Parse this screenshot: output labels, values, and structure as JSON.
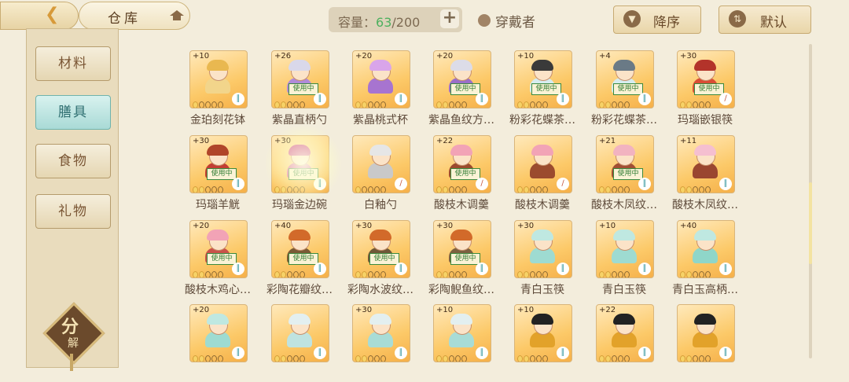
{
  "header": {
    "title": "仓库",
    "capacity_label": "容量：",
    "capacity_current": "63",
    "capacity_max": "/200",
    "capacity_add_icon": "plus-icon",
    "wearer_label": "穿戴者",
    "sort_order_label": "降序",
    "sort_default_label": "默认"
  },
  "sidebar": {
    "categories": [
      {
        "label": "材料",
        "active": false
      },
      {
        "label": "膳具",
        "active": true
      },
      {
        "label": "食物",
        "active": false
      },
      {
        "label": "礼物",
        "active": false
      }
    ],
    "decompose_label": "分",
    "decompose_sub": "解"
  },
  "status_badge_text": "使用中",
  "items": [
    {
      "name": "金珀刻花钵",
      "level": "+10",
      "in_use": false,
      "stars": 1,
      "tool": "teal",
      "hair": "#e9b850",
      "body": "#f2d58b"
    },
    {
      "name": "紫晶直柄勺",
      "level": "+26",
      "in_use": true,
      "stars": 2,
      "tool": "teal",
      "hair": "#d9d8ea",
      "body": "#b08ad8"
    },
    {
      "name": "紫晶桃式杯",
      "level": "+20",
      "in_use": false,
      "stars": 2,
      "tool": "teal",
      "hair": "#d9a5ea",
      "body": "#a774d0"
    },
    {
      "name": "紫晶鱼纹方…",
      "level": "+20",
      "in_use": true,
      "stars": 2,
      "tool": "teal",
      "hair": "#dcdce8",
      "body": "#9a6fc8"
    },
    {
      "name": "粉彩花蝶茶…",
      "level": "+10",
      "in_use": true,
      "stars": 2,
      "tool": "teal",
      "hair": "#3a3a3a",
      "body": "#d6ecef"
    },
    {
      "name": "粉彩花蝶茶…",
      "level": "+4",
      "in_use": true,
      "stars": 2,
      "tool": "teal",
      "hair": "#6a7a86",
      "body": "#d6ecef"
    },
    {
      "name": "玛瑙嵌银筷",
      "level": "+30",
      "in_use": true,
      "stars": 2,
      "tool": "red",
      "hair": "#b3332a",
      "body": "#d94d36"
    },
    {
      "name": "玛瑙羊觥",
      "level": "+30",
      "in_use": true,
      "stars": 2,
      "tool": "teal",
      "hair": "#b0452a",
      "body": "#c23d33"
    },
    {
      "name": "玛瑙金边碗",
      "level": "+30",
      "in_use": true,
      "stars": 2,
      "tool": "teal",
      "hair": "#cf4e9a",
      "body": "#d65ea6"
    },
    {
      "name": "白釉勺",
      "level": "",
      "in_use": false,
      "stars": 1,
      "tool": "red",
      "hair": "#e6e6e6",
      "body": "#c9c9c9"
    },
    {
      "name": "酸枝木调羹",
      "level": "+22",
      "in_use": true,
      "stars": 2,
      "tool": "red",
      "hair": "#f2a3b6",
      "body": "#9b4b2e"
    },
    {
      "name": "酸枝木调羹",
      "level": "",
      "in_use": false,
      "stars": 2,
      "tool": "red",
      "hair": "#f2a3b6",
      "body": "#9b4b2e"
    },
    {
      "name": "酸枝木凤纹…",
      "level": "+21",
      "in_use": true,
      "stars": 2,
      "tool": "teal",
      "hair": "#f2b3c0",
      "body": "#a14f34"
    },
    {
      "name": "酸枝木凤纹…",
      "level": "+11",
      "in_use": false,
      "stars": 2,
      "tool": "teal",
      "hair": "#f5bfd0",
      "body": "#9a4630"
    },
    {
      "name": "酸枝木鸡心…",
      "level": "+20",
      "in_use": true,
      "stars": 2,
      "tool": "teal",
      "hair": "#f2a3b6",
      "body": "#c9534a"
    },
    {
      "name": "彩陶花瓣纹…",
      "level": "+40",
      "in_use": true,
      "stars": 2,
      "tool": "teal",
      "hair": "#d26a2a",
      "body": "#7a5a36"
    },
    {
      "name": "彩陶水波纹…",
      "level": "+30",
      "in_use": true,
      "stars": 2,
      "tool": "teal",
      "hair": "#d26a2a",
      "body": "#6f5838"
    },
    {
      "name": "彩陶鲵鱼纹…",
      "level": "+30",
      "in_use": true,
      "stars": 2,
      "tool": "teal",
      "hair": "#d26a2a",
      "body": "#7c6140"
    },
    {
      "name": "青白玉筷",
      "level": "+30",
      "in_use": false,
      "stars": 2,
      "tool": "teal",
      "hair": "#bfe8e1",
      "body": "#9edbd1"
    },
    {
      "name": "青白玉筷",
      "level": "+10",
      "in_use": false,
      "stars": 2,
      "tool": "teal",
      "hair": "#bfe8e1",
      "body": "#9edbd1"
    },
    {
      "name": "青白玉高柄…",
      "level": "+40",
      "in_use": false,
      "stars": 2,
      "tool": "teal",
      "hair": "#bfe8e1",
      "body": "#8fd6c9"
    },
    {
      "name": "",
      "level": "+20",
      "in_use": false,
      "stars": 2,
      "tool": "teal",
      "hair": "#bfe8e1",
      "body": "#9edbd1"
    },
    {
      "name": "",
      "level": "",
      "in_use": false,
      "stars": 2,
      "tool": "teal",
      "hair": "#e3eff0",
      "body": "#bfe3e0"
    },
    {
      "name": "",
      "level": "+30",
      "in_use": false,
      "stars": 2,
      "tool": "teal",
      "hair": "#e3eff0",
      "body": "#a8dcd6"
    },
    {
      "name": "",
      "level": "+10",
      "in_use": false,
      "stars": 2,
      "tool": "teal",
      "hair": "#e3eff0",
      "body": "#a8dcd6"
    },
    {
      "name": "",
      "level": "+10",
      "in_use": false,
      "stars": 2,
      "tool": "teal",
      "hair": "#222222",
      "body": "#e2a22a"
    },
    {
      "name": "",
      "level": "+22",
      "in_use": false,
      "stars": 2,
      "tool": "teal",
      "hair": "#222222",
      "body": "#e2a22a"
    },
    {
      "name": "",
      "level": "",
      "in_use": false,
      "stars": 2,
      "tool": "teal",
      "hair": "#222222",
      "body": "#e2a22a"
    }
  ]
}
